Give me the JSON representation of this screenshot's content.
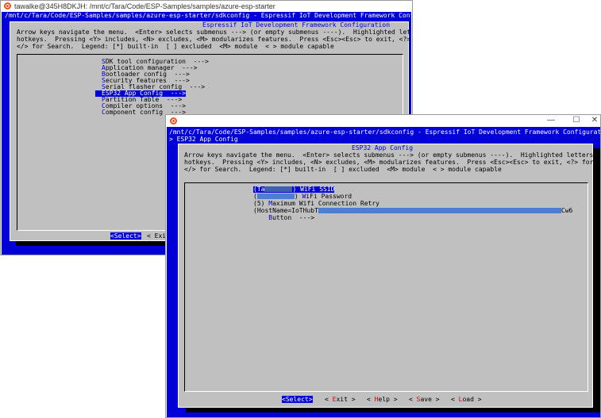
{
  "window1": {
    "title": "tawalke@345H8DKJH: /mnt/c/Tara/Code/ESP-Samples/samples/azure-esp-starter",
    "path_line": "/mnt/c/Tara/Code/ESP-Samples/samples/azure-esp-starter/sdkconfig - Espressif IoT Development Framework Configuration",
    "dialog_title": "Espressif IoT Development Framework Configuration",
    "help_lines": [
      "Arrow keys navigate the menu.  <Enter> selects submenus ---> (or empty submenus ----).  Highlighted letters are",
      "hotkeys.  Pressing <Y> includes, <N> excludes, <M> modularizes features.  Press <Esc><Esc> to exit, <?> for Help,",
      "</> for Search.  Legend: [*] built-in  [ ] excluded  <M> module  < > module capable"
    ],
    "menu_items": [
      {
        "hot": "S",
        "rest": "DK tool configuration  --->"
      },
      {
        "hot": "A",
        "rest": "pplication manager  --->"
      },
      {
        "hot": "B",
        "rest": "ootloader config  --->"
      },
      {
        "hot": "S",
        "rest": "ecurity features  --->"
      },
      {
        "hot": "S",
        "rest": "erial flasher config  --->"
      },
      {
        "hot": "E",
        "rest": "SP32 App Config  --->"
      },
      {
        "hot": "P",
        "rest": "artition Table  --->"
      },
      {
        "hot": "C",
        "rest": "ompiler options  --->"
      },
      {
        "hot": "C",
        "rest": "omponent config  --->"
      }
    ],
    "selected_index": 5,
    "buttons": {
      "select": "<Select>",
      "exit": "< Exi"
    }
  },
  "window2": {
    "title_bar_controls": {
      "minimize": "—",
      "maximize": "☐",
      "close": "✕"
    },
    "path_line": "/mnt/c/Tara/Code/ESP-Samples/samples/azure-esp-starter/sdkconfig - Espressif IoT Development Framework Configuration",
    "breadcrumb": "> ESP32 App Config",
    "dialog_title": "ESP32 App Config",
    "help_lines": [
      "Arrow keys navigate the menu.  <Enter> selects submenus ---> (or empty submenus ----).  Highlighted letters are",
      "hotkeys.  Pressing <Y> includes, <N> excludes, <M> modularizes features.  Press <Esc><Esc> to exit, <?> for Help,",
      "</> for Search.  Legend: [*] built-in  [ ] excluded  <M> module  < > module capable"
    ],
    "menu_items": [
      {
        "prefix": "(Ta",
        "hot": "W",
        "rest": "iFi SSID"
      },
      {
        "prefix": "(",
        "hot": "W",
        "rest": "iFi Password"
      },
      {
        "prefix": "(5) ",
        "hot": "M",
        "rest": "aximum Wifi Connection Retry"
      },
      {
        "prefix": "(HostName=IoTHubT",
        "hot": "",
        "rest": "Cw6"
      },
      {
        "prefix": "    ",
        "hot": "B",
        "rest": "utton  --->"
      }
    ],
    "buttons": {
      "select": "<Select>",
      "exit": {
        "pre": "< ",
        "hot": "E",
        "post": "xit >"
      },
      "help": {
        "pre": "< ",
        "hot": "H",
        "post": "elp >"
      },
      "save": {
        "pre": "< ",
        "hot": "S",
        "post": "ave >"
      },
      "load": {
        "pre": "< ",
        "hot": "L",
        "post": "oad >"
      }
    }
  },
  "colors": {
    "terminal_blue": "#0000d7",
    "dialog_gray": "#c0c0c0",
    "hotkey_red": "#d70000",
    "ubuntu_orange": "#e95420"
  }
}
